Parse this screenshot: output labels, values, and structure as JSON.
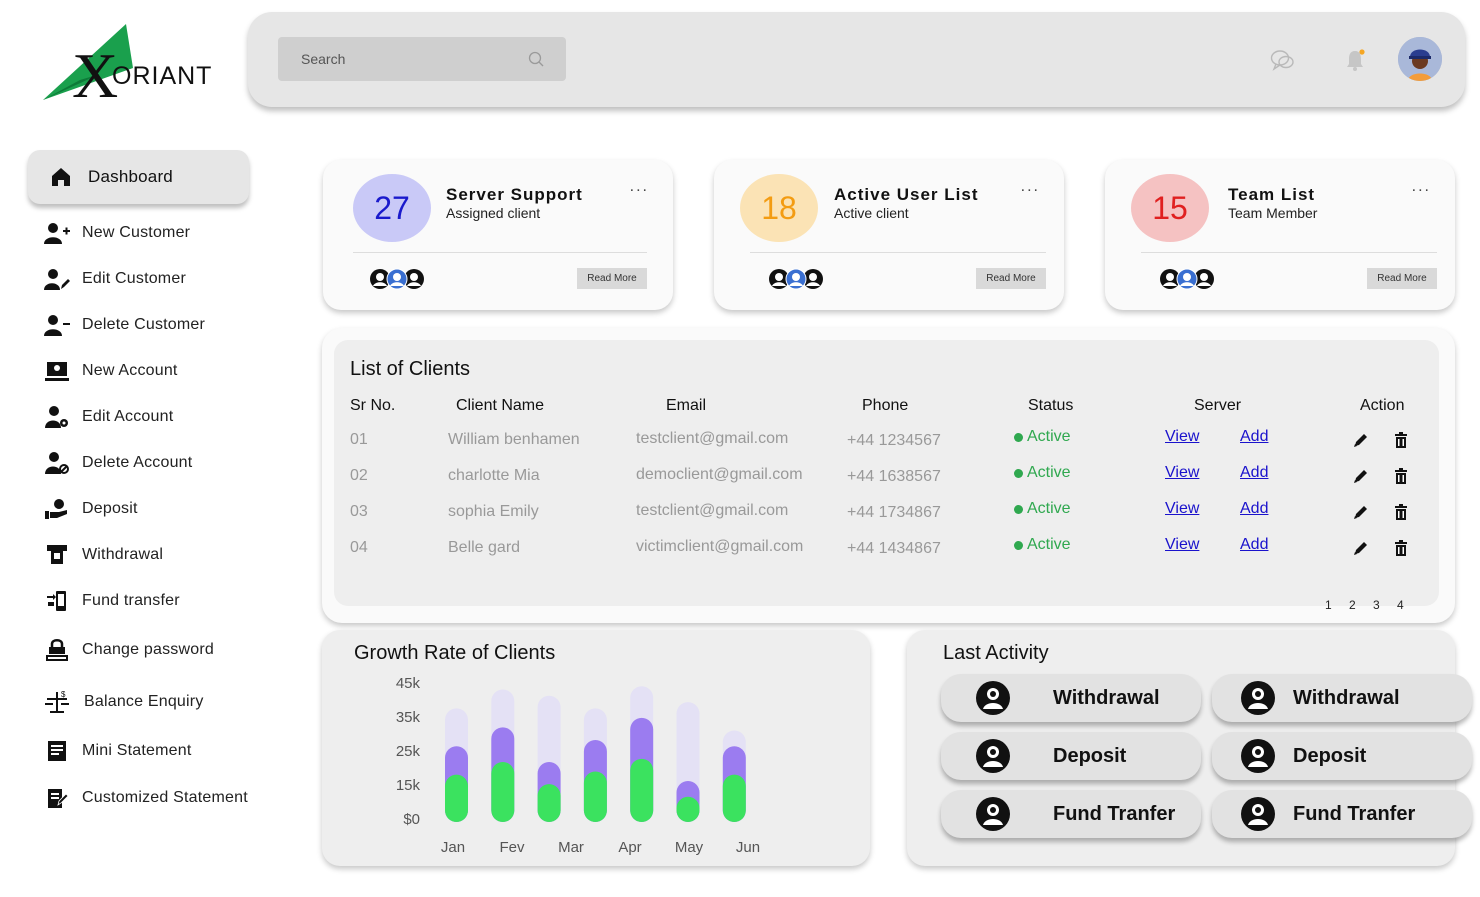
{
  "brand": {
    "name": "ORIANT",
    "initial": "X"
  },
  "topbar": {
    "search_placeholder": "Search"
  },
  "sidebar": {
    "items": [
      {
        "label": "Dashboard",
        "icon": "home-icon"
      },
      {
        "label": "New Customer",
        "icon": "user-plus-icon"
      },
      {
        "label": "Edit Customer",
        "icon": "user-edit-icon"
      },
      {
        "label": "Delete Customer",
        "icon": "user-minus-icon"
      },
      {
        "label": "New Account",
        "icon": "account-card-icon"
      },
      {
        "label": "Edit Account",
        "icon": "user-gear-icon"
      },
      {
        "label": "Delete Account",
        "icon": "user-block-icon"
      },
      {
        "label": "Deposit",
        "icon": "hand-coin-icon"
      },
      {
        "label": "Withdrawal",
        "icon": "atm-icon"
      },
      {
        "label": "Fund transfer",
        "icon": "phone-transfer-icon"
      },
      {
        "label": "Change password",
        "icon": "lock-keyboard-icon"
      },
      {
        "label": "Balance Enquiry",
        "icon": "balance-icon"
      },
      {
        "label": "Mini Statement",
        "icon": "receipt-icon"
      },
      {
        "label": "Customized Statement",
        "icon": "statement-edit-icon"
      }
    ]
  },
  "cards": [
    {
      "number": "27",
      "title": "Server Support",
      "subtitle": "Assigned client",
      "dots": "...",
      "button": "Read More",
      "color": "#c9c9f7",
      "number_color": "#1a1acc"
    },
    {
      "number": "18",
      "title": "Active User List",
      "subtitle": "Active client",
      "dots": "...",
      "button": "Read More",
      "color": "#fbe3b5",
      "number_color": "#f39c12"
    },
    {
      "number": "15",
      "title": "Team List",
      "subtitle": "Team Member",
      "dots": "...",
      "button": "Read More",
      "color": "#f5c2c2",
      "number_color": "#e02020"
    }
  ],
  "clients": {
    "title": "List of Clients",
    "headers": [
      "Sr No.",
      "Client Name",
      "Email",
      "Phone",
      "Status",
      "Server",
      "Action"
    ],
    "rows": [
      {
        "sr": "01",
        "name": "William benhamen",
        "email": "testclient@gmail.com",
        "phone": "+44 1234567",
        "status": "Active",
        "view": "View",
        "add": "Add"
      },
      {
        "sr": "02",
        "name": "charlotte Mia",
        "email": "democlient@gmail.com",
        "phone": "+44 1638567",
        "status": "Active",
        "view": "View",
        "add": "Add"
      },
      {
        "sr": "03",
        "name": "sophia Emily",
        "email": "testclient@gmail.com",
        "phone": "+44 1734867",
        "status": "Active",
        "view": "View",
        "add": "Add"
      },
      {
        "sr": "04",
        "name": "Belle gard",
        "email": "victimclient@gmail.com",
        "phone": "+44 1434867",
        "status": "Active",
        "view": "View",
        "add": "Add"
      }
    ],
    "pages": [
      "1",
      "2",
      "3",
      "4"
    ]
  },
  "chart_data": {
    "type": "bar",
    "title": "Growth Rate of Clients",
    "categories": [
      "Jan",
      "Fev",
      "Mar",
      "Apr",
      "May",
      "Jun"
    ],
    "y_ticks": [
      "45k",
      "35k",
      "25k",
      "15k",
      "$0"
    ],
    "ylim": [
      0,
      45000
    ],
    "series": [
      {
        "values": [
          36000,
          42000,
          40000,
          36000,
          43000,
          38000,
          29000
        ],
        "color": "#e4e1f5"
      },
      {
        "values": [
          24000,
          30000,
          19000,
          26000,
          33000,
          13000,
          24000
        ],
        "color": "#9b7cf0"
      },
      {
        "values": [
          15000,
          19000,
          12000,
          16000,
          20000,
          8000,
          15000
        ],
        "color": "#3be25f"
      }
    ]
  },
  "activity": {
    "title": "Last Activity",
    "items": [
      "Withdrawal",
      "Withdrawal",
      "Deposit",
      "Deposit",
      "Fund Tranfer",
      "Fund Tranfer"
    ]
  }
}
